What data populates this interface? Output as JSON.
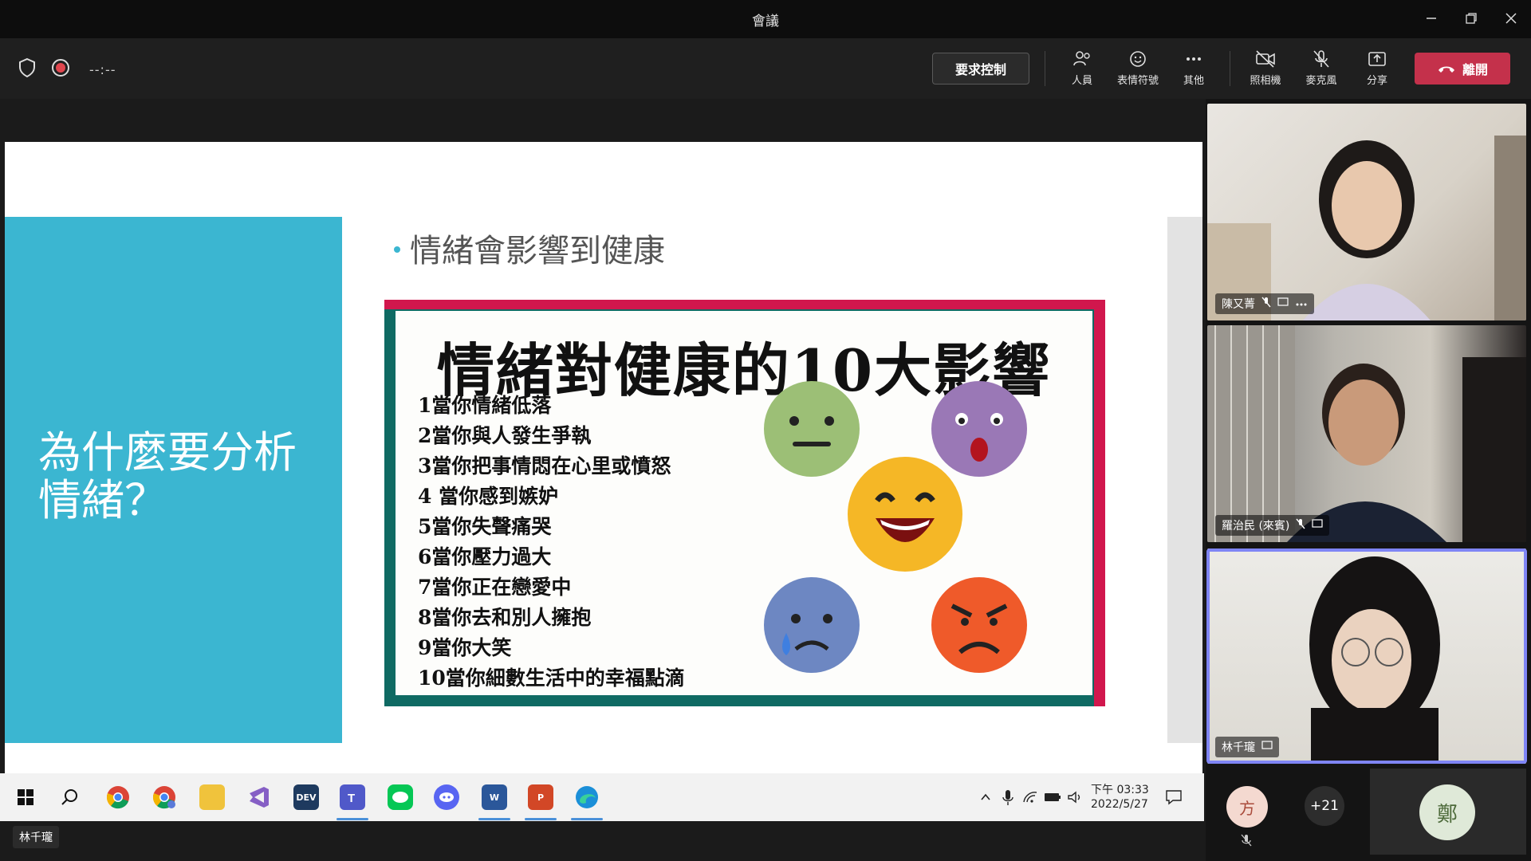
{
  "window": {
    "title": "會議"
  },
  "toolbar": {
    "timer": "--:--",
    "request_control": "要求控制",
    "people": "人員",
    "reactions": "表情符號",
    "more": "其他",
    "camera": "照相機",
    "mic": "麥克風",
    "share": "分享",
    "leave": "離開"
  },
  "slide": {
    "heading": "為什麼要分析情緒？",
    "bullet": "情緒會影響到健康",
    "poster_title": "情緒對健康的10大影響",
    "items": [
      "1當你情緒低落",
      "2當你與人發生爭執",
      "3當你把事情悶在心里或憤怒",
      "4  當你感到嫉妒",
      "5當你失聲痛哭",
      "6當你壓力過大",
      "7當你正在戀愛中",
      "8當你去和別人擁抱",
      "9當你大笑",
      "10當你細數生活中的幸福點滴"
    ]
  },
  "participants": [
    {
      "name": "陳又菁"
    },
    {
      "name": "羅治民 (來賓)"
    },
    {
      "name": "林千瓏"
    }
  ],
  "roster": {
    "avatar1": "方",
    "more_count": "+21",
    "avatar2": "鄭"
  },
  "taskbar": {
    "time": "下午 03:33",
    "date": "2022/5/27",
    "dev_label": "DEV",
    "word_label": "W",
    "ppt_label": "P"
  },
  "presenter_label": "林千瓏",
  "colors": {
    "accent": "#7f85f5",
    "leave": "#c4314b",
    "slide_cyan": "#3bb6d1"
  }
}
